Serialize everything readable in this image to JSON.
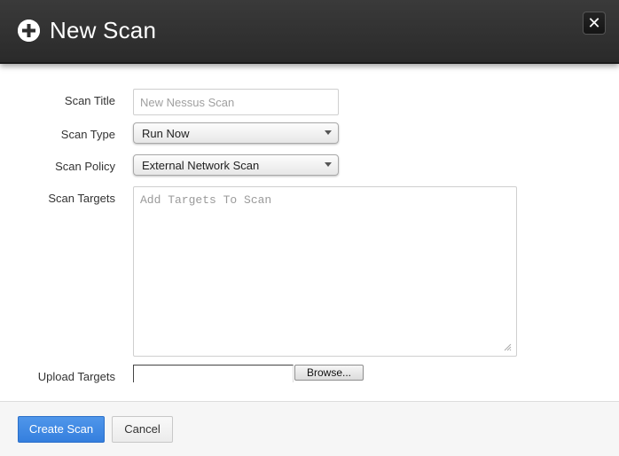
{
  "dialog": {
    "title": "New Scan",
    "header_icon": "plus-circle-icon",
    "close_icon": "close-icon",
    "close_glyph": "✕"
  },
  "form": {
    "scan_title": {
      "label": "Scan Title",
      "value": "",
      "placeholder": "New Nessus Scan"
    },
    "scan_type": {
      "label": "Scan Type",
      "selected": "Run Now",
      "icon": "chevron-down-icon"
    },
    "scan_policy": {
      "label": "Scan Policy",
      "selected": "External Network Scan",
      "icon": "chevron-down-icon"
    },
    "scan_targets": {
      "label": "Scan Targets",
      "value": "",
      "placeholder": "Add Targets To Scan"
    },
    "upload_targets": {
      "label": "Upload Targets",
      "browse_label": "Browse..."
    }
  },
  "footer": {
    "create_label": "Create Scan",
    "cancel_label": "Cancel"
  },
  "colors": {
    "header_bg": "#2f2f2f",
    "primary_button": "#3d87e2",
    "footer_bg": "#f6f6f6"
  }
}
